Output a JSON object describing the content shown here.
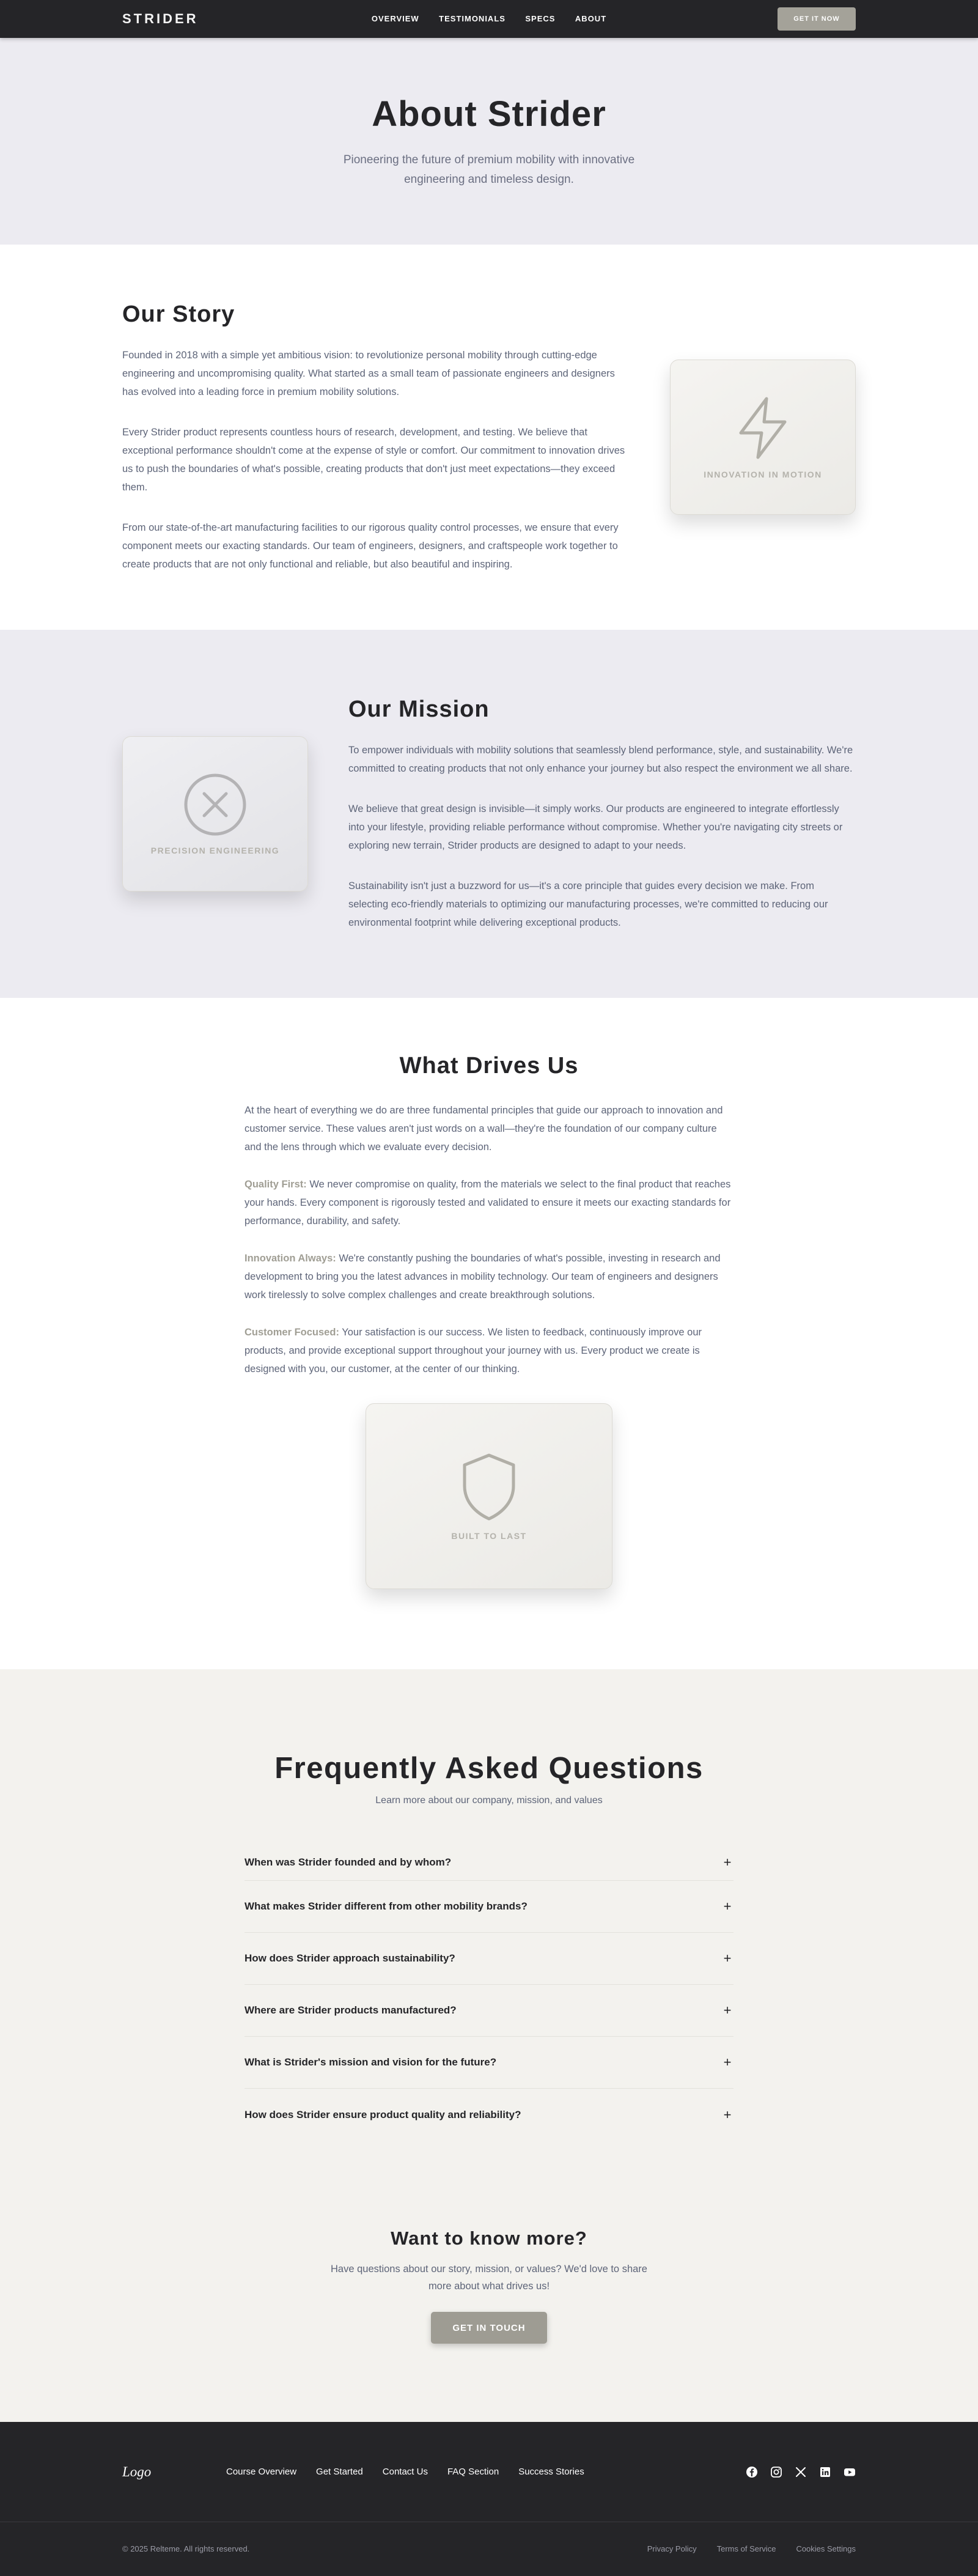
{
  "nav": {
    "brand": "STRIDER",
    "links": [
      "OVERVIEW",
      "TESTIMONIALS",
      "SPECS",
      "ABOUT"
    ],
    "cta": "GET IT NOW"
  },
  "hero": {
    "title": "About Strider",
    "subtitle": "Pioneering the future of premium mobility with innovative engineering and timeless design."
  },
  "story": {
    "title": "Our Story",
    "paragraphs": [
      "Founded in 2018 with a simple yet ambitious vision: to revolutionize personal mobility through cutting-edge engineering and uncompromising quality. What started as a small team of passionate engineers and designers has evolved into a leading force in premium mobility solutions.",
      "Every Strider product represents countless hours of research, development, and testing. We believe that exceptional performance shouldn't come at the expense of style or comfort. Our commitment to innovation drives us to push the boundaries of what's possible, creating products that don't just meet expectations—they exceed them.",
      "From our state-of-the-art manufacturing facilities to our rigorous quality control processes, we ensure that every component meets our exacting standards. Our team of engineers, designers, and craftspeople work together to create products that are not only functional and reliable, but also beautiful and inspiring."
    ],
    "card_label": "INNOVATION IN MOTION",
    "card_icon": "lightning-icon"
  },
  "mission": {
    "title": "Our Mission",
    "paragraphs": [
      "To empower individuals with mobility solutions that seamlessly blend performance, style, and sustainability. We're committed to creating products that not only enhance your journey but also respect the environment we all share.",
      "We believe that great design is invisible—it simply works. Our products are engineered to integrate effortlessly into your lifestyle, providing reliable performance without compromise. Whether you're navigating city streets or exploring new terrain, Strider products are designed to adapt to your needs.",
      "Sustainability isn't just a buzzword for us—it's a core principle that guides every decision we make. From selecting eco-friendly materials to optimizing our manufacturing processes, we're committed to reducing our environmental footprint while delivering exceptional products."
    ],
    "card_label": "PRECISION ENGINEERING",
    "card_icon": "circle-x-icon"
  },
  "drives": {
    "title": "What Drives Us",
    "intro": "At the heart of everything we do are three fundamental principles that guide our approach to innovation and customer service. These values aren't just words on a wall—they're the foundation of our company culture and the lens through which we evaluate every decision.",
    "principles": [
      {
        "name": "Quality First:",
        "text": " We never compromise on quality, from the materials we select to the final product that reaches your hands. Every component is rigorously tested and validated to ensure it meets our exacting standards for performance, durability, and safety."
      },
      {
        "name": "Innovation Always:",
        "text": " We're constantly pushing the boundaries of what's possible, investing in research and development to bring you the latest advances in mobility technology. Our team of engineers and designers work tirelessly to solve complex challenges and create breakthrough solutions."
      },
      {
        "name": "Customer Focused:",
        "text": " Your satisfaction is our success. We listen to feedback, continuously improve our products, and provide exceptional support throughout your journey with us. Every product we create is designed with you, our customer, at the center of our thinking."
      }
    ],
    "card_label": "BUILT TO LAST",
    "card_icon": "shield-icon"
  },
  "faq": {
    "title": "Frequently Asked Questions",
    "subtitle": "Learn more about our company, mission, and values",
    "items": [
      "When was Strider founded and by whom?",
      "What makes Strider different from other mobility brands?",
      "How does Strider approach sustainability?",
      "Where are Strider products manufactured?",
      "What is Strider's mission and vision for the future?",
      "How does Strider ensure product quality and reliability?"
    ],
    "toggle": "+"
  },
  "more": {
    "title": "Want to know more?",
    "text": "Have questions about our story, mission, or values? We'd love to share more about what drives us!",
    "cta": "GET IN TOUCH"
  },
  "footer": {
    "logo": "Logo",
    "links": [
      "Course Overview",
      "Get Started",
      "Contact Us",
      "FAQ Section",
      "Success Stories"
    ],
    "social": [
      "facebook-icon",
      "instagram-icon",
      "x-icon",
      "linkedin-icon",
      "youtube-icon"
    ],
    "copyright": "© 2025 Relteme. All rights reserved.",
    "legal": [
      "Privacy Policy",
      "Terms of Service",
      "Cookies Settings"
    ]
  },
  "colors": {
    "accent": "#a09e94",
    "dark": "#252528",
    "section_alt": "#ecebf1",
    "faq_bg": "#f3f2ee",
    "body_text": "#5d6478"
  }
}
